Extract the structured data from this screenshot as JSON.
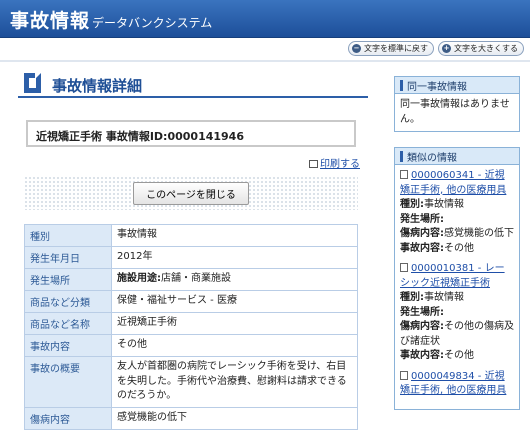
{
  "header": {
    "title_main": "事故情報",
    "title_sub": "データバンクシステム"
  },
  "text_size": {
    "reset_label": "文字を標準に戻す",
    "enlarge_label": "文字を大きくする"
  },
  "page": {
    "title": "事故情報詳細",
    "id_line": "近視矯正手術 事故情報ID:0000141946",
    "print_label": "印刷する",
    "close_label": "このページを閉じる"
  },
  "info_rows": [
    {
      "key": "種別",
      "value": "事故情報"
    },
    {
      "key": "発生年月日",
      "value": "2012年"
    },
    {
      "key": "発生場所",
      "label": "施設用途:",
      "value": "店舗・商業施設"
    },
    {
      "key": "商品など分類",
      "value": "保健・福祉サービス - 医療"
    },
    {
      "key": "商品など名称",
      "value": "近視矯正手術"
    },
    {
      "key": "事故内容",
      "value": "その他"
    },
    {
      "key": "事故の概要",
      "value": "友人が首都圏の病院でレーシック手術を受け、右目を失明した。手術代や治療費、慰謝料は請求できるのだろうか。"
    },
    {
      "key": "傷病内容",
      "value": "感覚機能の低下"
    }
  ],
  "sidebar": {
    "same": {
      "title": "同一事故情報",
      "body": "同一事故情報はありません。"
    },
    "similar": {
      "title": "類似の情報",
      "items": [
        {
          "link": "0000060341 - 近視矯正手術, 他の医療用具",
          "type_label": "種別:",
          "type": "事故情報",
          "place_label": "発生場所:",
          "place": "",
          "injury_label": "傷病内容:",
          "injury": "感覚機能の低下",
          "accident_label": "事故内容:",
          "accident": "その他"
        },
        {
          "link": "0000010381 - レーシック近視矯正手術",
          "type_label": "種別:",
          "type": "事故情報",
          "place_label": "発生場所:",
          "place": "",
          "injury_label": "傷病内容:",
          "injury": "その他の傷病及び諸症状",
          "accident_label": "事故内容:",
          "accident": "その他"
        },
        {
          "link": "0000049834 - 近視矯正手術, 他の医療用具"
        }
      ]
    }
  }
}
